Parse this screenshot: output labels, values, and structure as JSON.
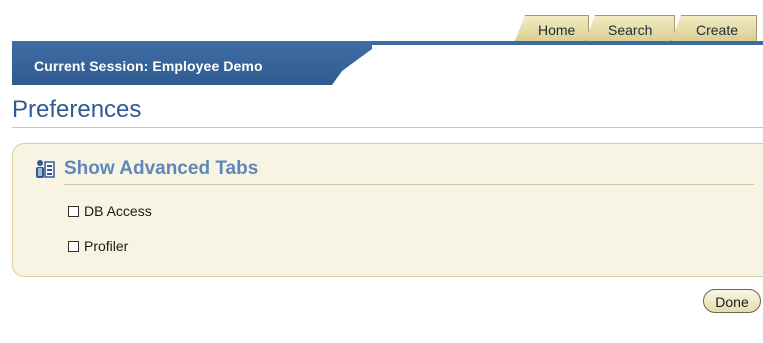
{
  "tabs": [
    {
      "label": "Home"
    },
    {
      "label": "Search"
    },
    {
      "label": "Create"
    }
  ],
  "session": {
    "label": "Current Session: Employee Demo"
  },
  "page": {
    "title": "Preferences"
  },
  "section": {
    "title": "Show Advanced Tabs",
    "icon": "user-settings-icon",
    "options": [
      {
        "label": "DB Access",
        "checked": false
      },
      {
        "label": "Profiler",
        "checked": false
      }
    ]
  },
  "actions": {
    "done_label": "Done"
  },
  "colors": {
    "brand_blue": "#2f5b90",
    "section_title": "#5f88b8",
    "tab_tan": "#e7dfae",
    "panel_bg": "#f7f4e3"
  }
}
